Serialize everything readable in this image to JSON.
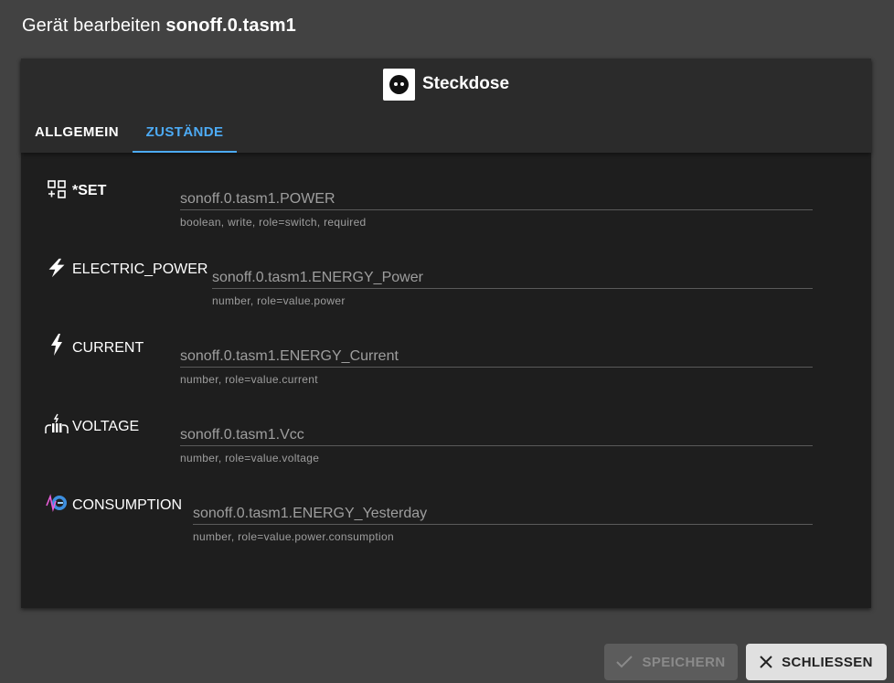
{
  "dialog": {
    "title_prefix": "Gerät bearbeiten ",
    "title_device": "sonoff.0.tasm1"
  },
  "device": {
    "type_icon": "power-socket-icon",
    "type_label": "Steckdose"
  },
  "tabs": [
    {
      "label": "ALLGEMEIN",
      "active": false
    },
    {
      "label": "ZUSTÄNDE",
      "active": true
    }
  ],
  "colors": {
    "accent": "#4dabf5",
    "background": "#424242",
    "panel": "#1e1e1e"
  },
  "states": [
    {
      "icon": "widgets-icon",
      "name": "*SET",
      "value": "sonoff.0.tasm1.POWER",
      "help": "boolean, write, role=switch, required"
    },
    {
      "icon": "flash-icon",
      "name": "ELECTRIC_POWER",
      "value": "sonoff.0.tasm1.ENERGY_Power",
      "help": "number, role=value.power"
    },
    {
      "icon": "bolt-icon",
      "name": "CURRENT",
      "value": "sonoff.0.tasm1.ENERGY_Current",
      "help": "number, role=value.current"
    },
    {
      "icon": "voltage-icon",
      "name": "VOLTAGE",
      "value": "sonoff.0.tasm1.Vcc",
      "help": "number, role=value.voltage"
    },
    {
      "icon": "consumption-icon",
      "name": "CONSUMPTION",
      "value": "sonoff.0.tasm1.ENERGY_Yesterday",
      "help": "number, role=value.power.consumption"
    }
  ],
  "buttons": {
    "save_label": "SPEICHERN",
    "save_icon": "check-icon",
    "save_enabled": false,
    "close_label": "SCHLIESSEN",
    "close_icon": "close-icon"
  }
}
